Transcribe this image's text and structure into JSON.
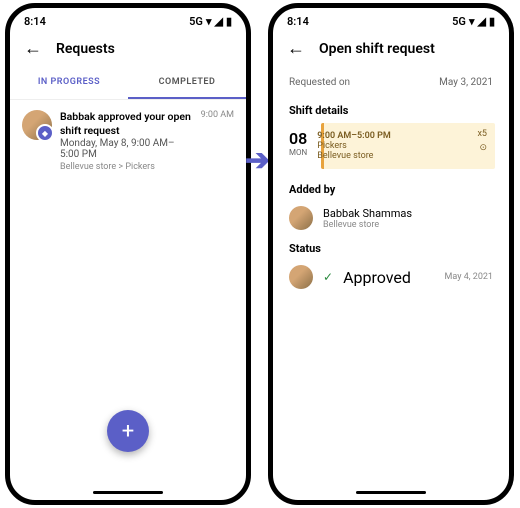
{
  "time": "8:14",
  "net": "5G",
  "left": {
    "title": "Requests",
    "tabs": {
      "inprogress": "IN PROGRESS",
      "completed": "COMPLETED"
    },
    "item": {
      "title": "Babbak approved your open shift request",
      "sub": "Monday, May 8, 9:00 AM–5:00 PM",
      "bc": "Bellevue store > Pickers",
      "time": "9:00 AM"
    }
  },
  "right": {
    "title": "Open shift request",
    "reqlabel": "Requested on",
    "reqdate": "May 3, 2021",
    "sh_details": "Shift details",
    "shift": {
      "day": "08",
      "dow": "MON",
      "time": "9:00 AM–5:00 PM",
      "group": "Pickers",
      "store": "Bellevue store",
      "count": "x5"
    },
    "sh_added": "Added by",
    "adder": {
      "name": "Babbak Shammas",
      "store": "Bellevue store"
    },
    "sh_status": "Status",
    "status": {
      "label": "Approved",
      "date": "May 4, 2021"
    }
  }
}
